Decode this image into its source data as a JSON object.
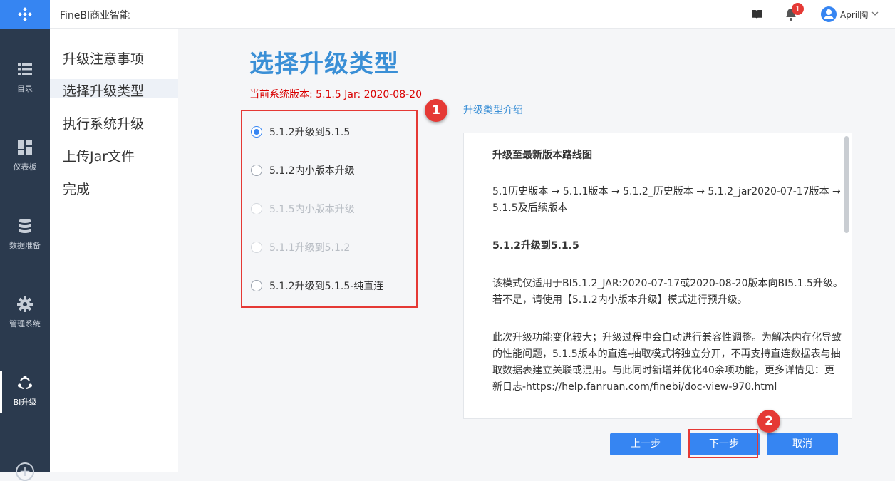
{
  "app": {
    "title": "FineBI商业智能"
  },
  "header": {
    "notification_count": "1",
    "user_name": "April陶"
  },
  "rail": {
    "items": [
      {
        "label": "目录",
        "icon": "list-icon"
      },
      {
        "label": "仪表板",
        "icon": "dashboard-icon"
      },
      {
        "label": "数据准备",
        "icon": "database-icon"
      },
      {
        "label": "管理系统",
        "icon": "gear-icon"
      },
      {
        "label": "BI升级",
        "icon": "upgrade-icon",
        "active": true
      }
    ]
  },
  "steps": [
    {
      "label": "升级注意事项"
    },
    {
      "label": "选择升级类型",
      "active": true
    },
    {
      "label": "执行系统升级"
    },
    {
      "label": "上传Jar文件"
    },
    {
      "label": "完成"
    }
  ],
  "main": {
    "title": "选择升级类型",
    "version_text": "当前系统版本: 5.1.5  Jar: 2020-08-20",
    "options": [
      {
        "label": "5.1.2升级到5.1.5",
        "checked": true,
        "disabled": false
      },
      {
        "label": "5.1.2内小版本升级",
        "checked": false,
        "disabled": false
      },
      {
        "label": "5.1.5内小版本升级",
        "checked": false,
        "disabled": true
      },
      {
        "label": "5.1.1升级到5.1.2",
        "checked": false,
        "disabled": true
      },
      {
        "label": "5.1.2升级到5.1.5-纯直连",
        "checked": false,
        "disabled": false
      }
    ],
    "intro_link": "升级类型介绍",
    "intro": {
      "heading1": "升级至最新版本路线图",
      "roadmap": "5.1历史版本 → 5.1.1版本 → 5.1.2_历史版本 → 5.1.2_jar2020-07-17版本 → 5.1.5及后续版本",
      "heading2": "5.1.2升级到5.1.5",
      "para1": "该模式仅适用于BI5.1.2_JAR:2020-07-17或2020-08-20版本向BI5.1.5升级。若不是，请使用【5.1.2内小版本升级】模式进行预升级。",
      "para2": "此次升级功能变化较大；升级过程中会自动进行兼容性调整。为解决内存化导致的性能问题，5.1.5版本的直连-抽取模式将独立分开，不再支持直连数据表与抽取数据表建立关联或混用。与此同时新增并优化40余项功能，更多详情见：更新日志-https://help.fanruan.com/finebi/doc-view-970.html"
    },
    "buttons": {
      "prev": "上一步",
      "next": "下一步",
      "cancel": "取消"
    },
    "callouts": {
      "one": "1",
      "two": "2"
    }
  }
}
